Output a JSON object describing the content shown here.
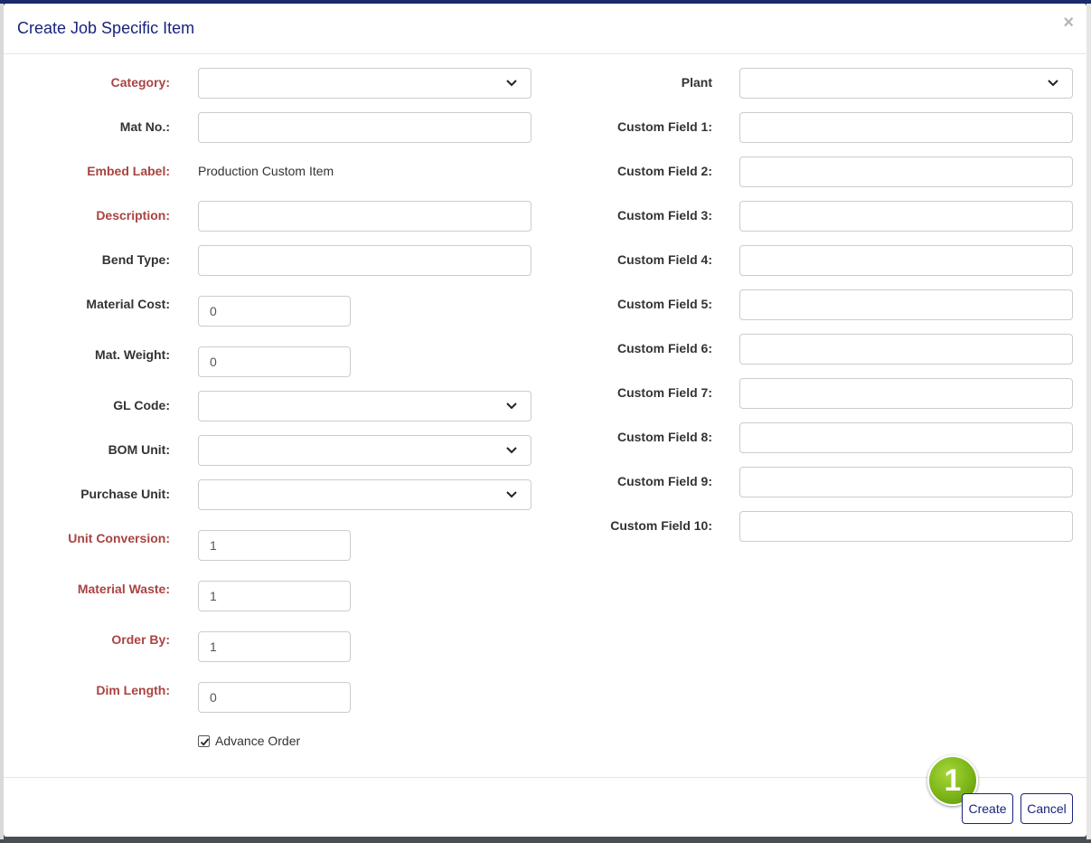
{
  "modal": {
    "title": "Create Job Specific Item",
    "close_glyph": "×"
  },
  "left_fields": {
    "category": {
      "label": "Category:",
      "required": true,
      "type": "select",
      "value": ""
    },
    "mat_no": {
      "label": "Mat No.:",
      "required": false,
      "type": "text",
      "value": ""
    },
    "embed_label": {
      "label": "Embed Label:",
      "required": true,
      "type": "static",
      "value": "Production Custom Item"
    },
    "description": {
      "label": "Description:",
      "required": true,
      "type": "text",
      "value": ""
    },
    "bend_type": {
      "label": "Bend Type:",
      "required": false,
      "type": "text",
      "value": ""
    },
    "material_cost": {
      "label": "Material Cost:",
      "required": false,
      "type": "number",
      "value": "0"
    },
    "mat_weight": {
      "label": "Mat. Weight:",
      "required": false,
      "type": "number",
      "value": "0"
    },
    "gl_code": {
      "label": "GL Code:",
      "required": false,
      "type": "select",
      "value": ""
    },
    "bom_unit": {
      "label": "BOM Unit:",
      "required": false,
      "type": "select",
      "value": ""
    },
    "purchase_unit": {
      "label": "Purchase Unit:",
      "required": false,
      "type": "select",
      "value": ""
    },
    "unit_conversion": {
      "label": "Unit Conversion:",
      "required": true,
      "type": "number",
      "value": "1"
    },
    "material_waste": {
      "label": "Material Waste:",
      "required": true,
      "type": "number",
      "value": "1"
    },
    "order_by": {
      "label": "Order By:",
      "required": true,
      "type": "number",
      "value": "1"
    },
    "dim_length": {
      "label": "Dim Length:",
      "required": true,
      "type": "number",
      "value": "0"
    }
  },
  "advance_order": {
    "label": "Advance Order",
    "checked": true
  },
  "right_fields": {
    "plant": {
      "label": "Plant",
      "type": "select",
      "value": ""
    },
    "custom_1": {
      "label": "Custom Field 1:",
      "value": ""
    },
    "custom_2": {
      "label": "Custom Field 2:",
      "value": ""
    },
    "custom_3": {
      "label": "Custom Field 3:",
      "value": ""
    },
    "custom_4": {
      "label": "Custom Field 4:",
      "value": ""
    },
    "custom_5": {
      "label": "Custom Field 5:",
      "value": ""
    },
    "custom_6": {
      "label": "Custom Field 6:",
      "value": ""
    },
    "custom_7": {
      "label": "Custom Field 7:",
      "value": ""
    },
    "custom_8": {
      "label": "Custom Field 8:",
      "value": ""
    },
    "custom_9": {
      "label": "Custom Field 9:",
      "value": ""
    },
    "custom_10": {
      "label": "Custom Field 10:",
      "value": ""
    }
  },
  "footer": {
    "create_label": "Create",
    "cancel_label": "Cancel",
    "callout_number": "1"
  },
  "colors": {
    "title": "#1a237e",
    "required_label": "#a94442",
    "label": "#333333",
    "callout": "#7cb518"
  },
  "icons": {
    "select_arrow": "chevron-down-icon",
    "checkbox": "checkmark-icon",
    "close": "close-icon"
  }
}
